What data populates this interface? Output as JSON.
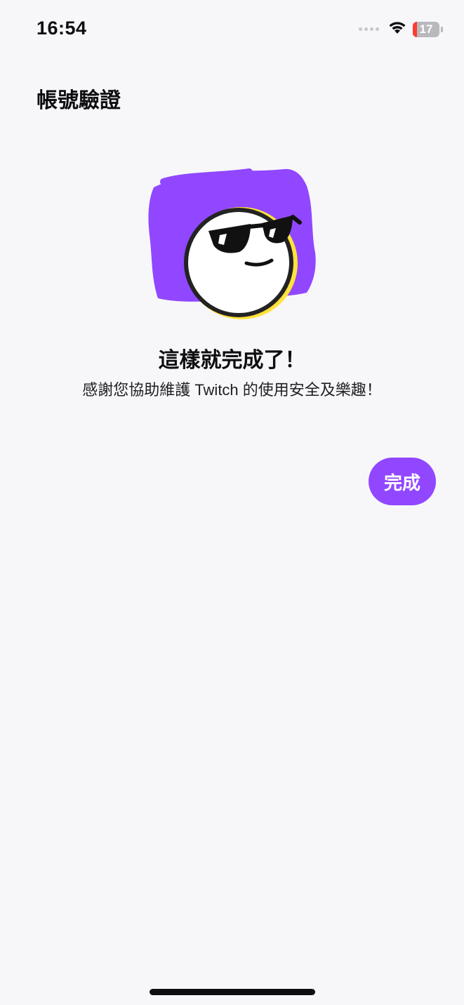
{
  "status_bar": {
    "time": "16:54",
    "battery_level": "17",
    "battery_fraction": 0.17,
    "icons": [
      "cellular-dots-icon",
      "wifi-icon",
      "battery-icon"
    ]
  },
  "header": {
    "title": "帳號驗證"
  },
  "main": {
    "illustration": "sunglasses-emote-illustration",
    "headline": "這樣就完成了！",
    "subtext": "感謝您協助維護 Twitch 的使用安全及樂趣！"
  },
  "actions": {
    "done_label": "完成"
  },
  "colors": {
    "accent": "#9147ff",
    "background": "#f7f7f9",
    "text": "#0e0e10",
    "battery_low": "#ff3b30",
    "emote_outline": "#ffe23b"
  }
}
